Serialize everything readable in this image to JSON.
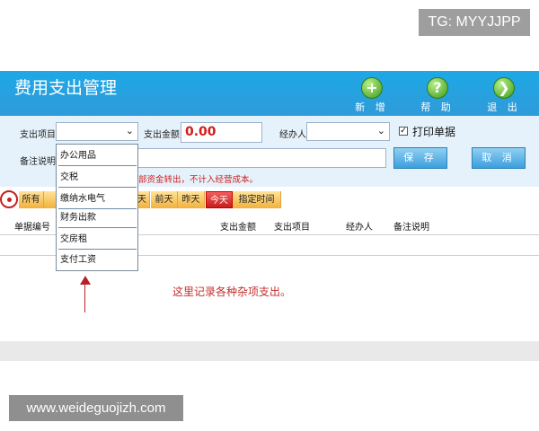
{
  "watermarks": {
    "top": "TG: MYYJJPP",
    "bottom": "www.weideguojizh.com"
  },
  "app": {
    "title": "费用支出管理"
  },
  "toolbar": {
    "add_label": "新 增",
    "help_label": "帮 助",
    "exit_label": "退 出"
  },
  "form": {
    "category_label": "支出项目",
    "amount_label": "支出金额",
    "amount_value": "0.00",
    "handler_label": "经办人",
    "print_label": "打印单据",
    "print_checked": true,
    "remark_label": "备注说明",
    "save_label": "保 存",
    "cancel_label": "取 消",
    "hint": "部资金转出，不计入经营成本。"
  },
  "category_options": [
    "办公用品",
    "交税",
    "缴纳水电气",
    "财务出款",
    "交房租",
    "支付工资"
  ],
  "date_filters": {
    "all": "所有",
    "x": "天",
    "before_yesterday": "前天",
    "yesterday": "昨天",
    "today": "今天",
    "specified": "指定时间"
  },
  "table": {
    "headers": {
      "bill_no": "单据编号",
      "amount": "支出金额",
      "category": "支出项目",
      "handler": "经办人",
      "remark": "备注说明"
    }
  },
  "annotation": "这里记录各种杂项支出。",
  "colors": {
    "header": "#2f9bd9",
    "form_bg": "#e6f2fb",
    "accent_red": "#c82020",
    "date_tab": "#f2b03b",
    "annotation": "#c0302e"
  }
}
